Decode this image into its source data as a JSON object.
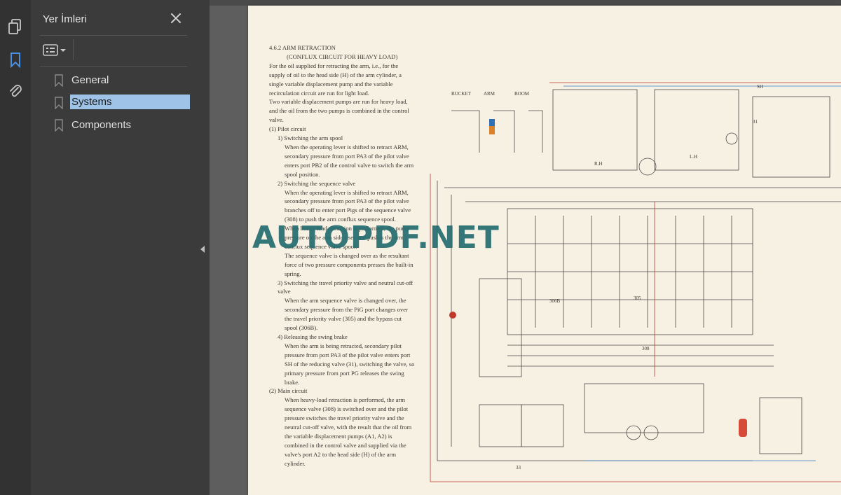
{
  "sidebar": {
    "title": "Yer İmleri",
    "items": [
      {
        "label": "General"
      },
      {
        "label": "Systems"
      },
      {
        "label": "Components"
      }
    ]
  },
  "rail": {
    "icons": [
      "pages-icon",
      "bookmark-icon",
      "attachment-icon"
    ]
  },
  "document": {
    "heading": "4.6.2  ARM RETRACTION",
    "subheading": "(CONFLUX CIRCUIT FOR HEAVY LOAD)",
    "paragraphs": [
      {
        "style": "ind1",
        "text": "For the oil supplied for retracting the arm, i.e., for the supply of oil to the head side (H) of the arm cylinder, a single variable displacement pump and the variable recirculation circuit are run for light load."
      },
      {
        "style": "ind1",
        "text": "Two variable displacement pumps are run for heavy load, and the oil from the two pumps is combined in the control valve."
      },
      {
        "style": "ind1",
        "text": "(1)  Pilot circuit"
      },
      {
        "style": "ind2",
        "text": "1)  Switching the arm spool"
      },
      {
        "style": "ind3",
        "text": "When the operating lever is shifted to retract ARM, secondary pressure from port PA3 of the pilot valve enters port PB2 of the control valve to switch the arm spool position."
      },
      {
        "style": "ind2",
        "text": "2)  Switching the sequence valve"
      },
      {
        "style": "ind3",
        "text": "When the operating lever is shifted to retract ARM, secondary pressure from port PA3 of the pilot valve branches off to enter port Pigs of the sequence valve (308) to push the arm conflux sequence spool."
      },
      {
        "style": "ind3",
        "text": "When heavy-load retraction is performed, the pump pressure on the arm side rises and pushes the arm conflux sequence valve spool."
      },
      {
        "style": "ind3",
        "text": "The sequence valve is changed over as the resultant force of two pressure components presses the built-in spring."
      },
      {
        "style": "ind2",
        "text": "3)  Switching the travel priority valve and neutral cut-off valve"
      },
      {
        "style": "ind3",
        "text": "When the arm sequence valve is changed over, the secondary pressure from the PiG port changes over the travel priority valve (305) and the bypass cut spool (306B)."
      },
      {
        "style": "ind2",
        "text": "4)  Releasing the swing brake"
      },
      {
        "style": "ind3",
        "text": "When the arm is being retracted, secondary pilot pressure from port PA3 of the pilot valve enters port SH of the reducing valve (31), switching the valve, so primary pressure from port PG releases the swing brake."
      },
      {
        "style": "ind1",
        "text": "(2)  Main circuit"
      },
      {
        "style": "ind3",
        "text": "When heavy-load retraction is performed, the arm sequence valve (308) is switched over and the pilot pressure switches the travel priority valve and the neutral cut-off valve, with the result that the oil from the variable displacement pumps (A1, A2) is combined in the control valve and supplied via the valve's port A2 to the head side (H) of the arm cylinder."
      }
    ],
    "watermark": "AUTOPDF.NET",
    "diagram_labels": [
      "BUCKET",
      "ARM",
      "BOOM",
      "R.H",
      "L.H",
      "306B",
      "305",
      "308",
      "SH",
      "31",
      "33"
    ]
  },
  "colors": {
    "rail_bg": "#323232",
    "panel_bg": "#3b3b3b",
    "selected_bg": "#9ec3e6",
    "page_bg": "#f7f1e3",
    "watermark": "#266e70"
  }
}
